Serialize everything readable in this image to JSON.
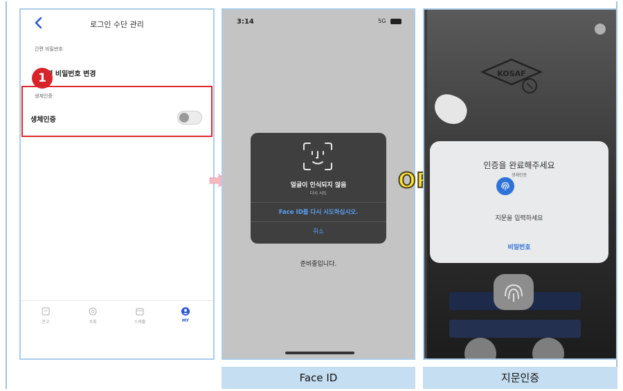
{
  "panel1": {
    "title": "로그인 수단 관리",
    "section_simple_password": "간편 비밀번호",
    "change_password": "간편 비밀번호 변경",
    "section_biometric": "생체인증",
    "biometric_label": "생체인증",
    "biometric_toggle": "off",
    "badge_number": "1",
    "tabs": [
      {
        "label": "잔고",
        "icon": "wallet-icon",
        "active": false
      },
      {
        "label": "조회",
        "icon": "search-icon",
        "active": false
      },
      {
        "label": "스캐줄",
        "icon": "calendar-icon",
        "active": false
      },
      {
        "label": "MY",
        "icon": "user-icon",
        "active": true
      }
    ]
  },
  "panel2": {
    "time": "3:14",
    "network": "5G",
    "dialog_title": "얼굴이 인식되지 않음",
    "dialog_subtitle": "다시 시도",
    "retry_label": "Face ID를 다시 시도하십시오.",
    "cancel_label": "취소",
    "preparing_text": "준비중입니다."
  },
  "or_label": "OR",
  "panel3": {
    "logo_text": "KOSAF",
    "card_title": "인증을 완료해주세요",
    "card_subtitle": "생체인증",
    "prompt": "지문을 입력하세요",
    "password_link": "비밀번호"
  },
  "captions": {
    "face_id": "Face ID",
    "fingerprint": "지문인증"
  },
  "colors": {
    "highlight": "#e0262a",
    "accent": "#2b56d6",
    "or_fill": "#f5e431",
    "caption_bg": "#c5def2"
  }
}
